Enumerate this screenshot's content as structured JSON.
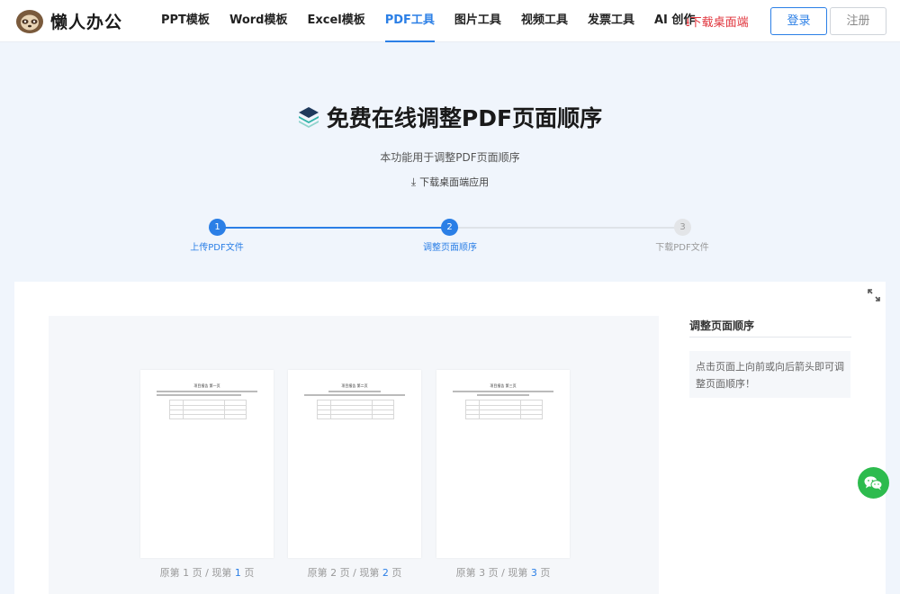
{
  "header": {
    "logo_text": "懒人办公",
    "nav": [
      "PPT模板",
      "Word模板",
      "Excel模板",
      "PDF工具",
      "图片工具",
      "视频工具",
      "发票工具",
      "AI 创作"
    ],
    "active_nav_index": 3,
    "download_link": "下载桌面端",
    "login_label": "登录",
    "register_label": "注册"
  },
  "hero": {
    "title": "免费在线调整PDF页面顺序",
    "subtitle": "本功能用于调整PDF页面顺序",
    "download_app": "下载桌面端应用"
  },
  "steps": [
    {
      "number": "1",
      "label": "上传PDF文件",
      "state": "done"
    },
    {
      "number": "2",
      "label": "调整页面顺序",
      "state": "active"
    },
    {
      "number": "3",
      "label": "下载PDF文件",
      "state": "pending"
    }
  ],
  "pages": [
    {
      "title": "项目报告 第一页",
      "caption_prefix": "原第 1 页 / 现第 ",
      "current": "1",
      "caption_suffix": " 页"
    },
    {
      "title": "项目报告 第二页",
      "caption_prefix": "原第 2 页 / 现第 ",
      "current": "2",
      "caption_suffix": " 页"
    },
    {
      "title": "项目报告 第三页",
      "caption_prefix": "原第 3 页 / 现第 ",
      "current": "3",
      "caption_suffix": " 页"
    }
  ],
  "side": {
    "title": "调整页面顺序",
    "tip": "点击页面上向前或向后箭头即可调整页面顺序！"
  },
  "colors": {
    "accent": "#2b7fe6",
    "danger": "#e0323a",
    "wechat": "#2dbb4e",
    "page_bg": "#f0f5fc"
  },
  "icons": [
    "sloth-logo-icon",
    "layers-icon",
    "download-icon",
    "expand-icon",
    "wechat-icon"
  ]
}
